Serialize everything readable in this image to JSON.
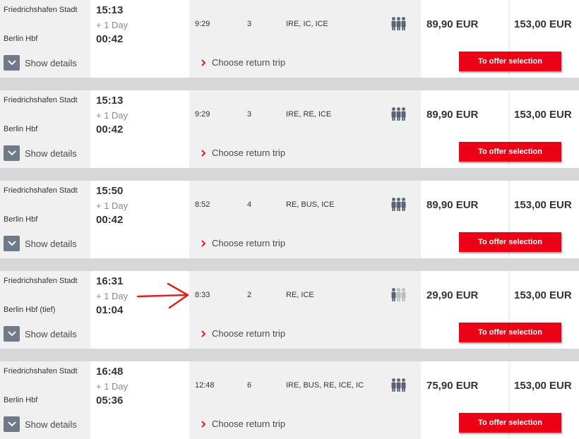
{
  "connections": [
    {
      "from": "Friedrichshafen Stadt",
      "to": "Berlin Hbf",
      "departure": "15:13",
      "day_offset": "+ 1 Day",
      "arrival": "00:42",
      "duration": "9:29",
      "changes": "3",
      "products": "IRE, IC, ICE",
      "occupancy_level": 3,
      "price_saver": "89,90 EUR",
      "price_flex": "153,00 EUR",
      "details_label": "Show details",
      "return_label": "Choose return trip",
      "offer_label": "To offer selection"
    },
    {
      "from": "Friedrichshafen Stadt",
      "to": "Berlin Hbf",
      "departure": "15:13",
      "day_offset": "+ 1 Day",
      "arrival": "00:42",
      "duration": "9:29",
      "changes": "3",
      "products": "IRE, RE, ICE",
      "occupancy_level": 3,
      "price_saver": "89,90 EUR",
      "price_flex": "153,00 EUR",
      "details_label": "Show details",
      "return_label": "Choose return trip",
      "offer_label": "To offer selection"
    },
    {
      "from": "Friedrichshafen Stadt",
      "to": "Berlin Hbf",
      "departure": "15:50",
      "day_offset": "+ 1 Day",
      "arrival": "00:42",
      "duration": "8:52",
      "changes": "4",
      "products": "RE, BUS, ICE",
      "occupancy_level": 3,
      "price_saver": "89,90 EUR",
      "price_flex": "153,00 EUR",
      "details_label": "Show details",
      "return_label": "Choose return trip",
      "offer_label": "To offer selection"
    },
    {
      "from": "Friedrichshafen Stadt",
      "to": "Berlin Hbf (tief)",
      "departure": "16:31",
      "day_offset": "+ 1 Day",
      "arrival": "01:04",
      "duration": "8:33",
      "changes": "2",
      "products": "RE, ICE",
      "occupancy_level": 1,
      "price_saver": "29,90 EUR",
      "price_flex": "153,00 EUR",
      "details_label": "Show details",
      "return_label": "Choose return trip",
      "offer_label": "To offer selection"
    },
    {
      "from": "Friedrichshafen Stadt",
      "to": "Berlin Hbf",
      "departure": "16:48",
      "day_offset": "+ 1 Day",
      "arrival": "05:36",
      "duration": "12:48",
      "changes": "6",
      "products": "IRE, BUS, RE, ICE, IC",
      "occupancy_level": 3,
      "price_saver": "75,90 EUR",
      "price_flex": "153,00 EUR",
      "details_label": "Show details",
      "return_label": "Choose return trip",
      "offer_label": "To offer selection"
    }
  ],
  "colors": {
    "accent_red": "#ec0016",
    "chevron_bg": "#6e7a88",
    "occupancy_filled": "#5a6470",
    "occupancy_empty": "#b9bec4",
    "annotation_arrow": "#e02020"
  },
  "icons": {
    "expand": "chevron-down-icon",
    "return": "chevron-right-icon",
    "occupancy": "occupancy-icon",
    "annotation": "annotation-arrow-icon"
  }
}
